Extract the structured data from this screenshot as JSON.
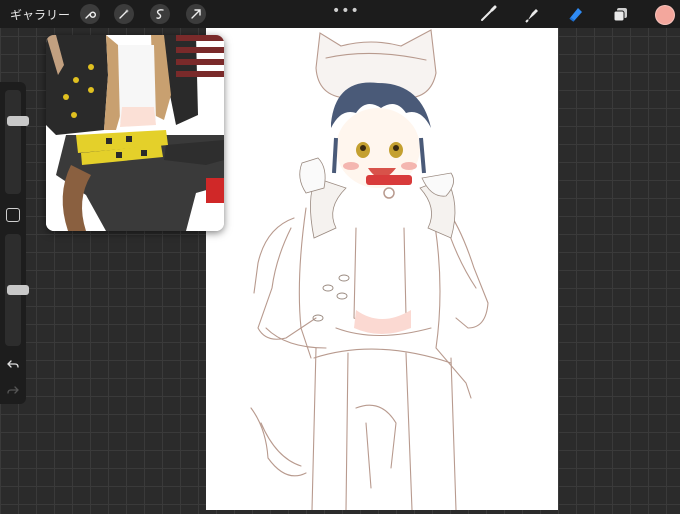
{
  "toolbar": {
    "gallery_label": "ギャラリー",
    "left_tools": [
      "wrench-icon",
      "magic-wand-icon",
      "selection-icon",
      "transform-icon"
    ],
    "more_menu": "•••",
    "right_tools": [
      "brush-icon",
      "smudge-icon",
      "eraser-icon",
      "layers-icon"
    ],
    "active_tool": "eraser-icon",
    "current_color": "#f3a79d"
  },
  "sidebar": {
    "brush_size_level": 0.72,
    "opacity_level": 0.5,
    "buttons": [
      "modify-button",
      "undo-button",
      "redo-button"
    ]
  },
  "colors": {
    "interface_background": "#2b2b2b",
    "toolbar_background": "#1c1c1c",
    "canvas": "#ffffff",
    "sketch_line": "#b89a8e",
    "accent_active": "#2f8bf5"
  }
}
